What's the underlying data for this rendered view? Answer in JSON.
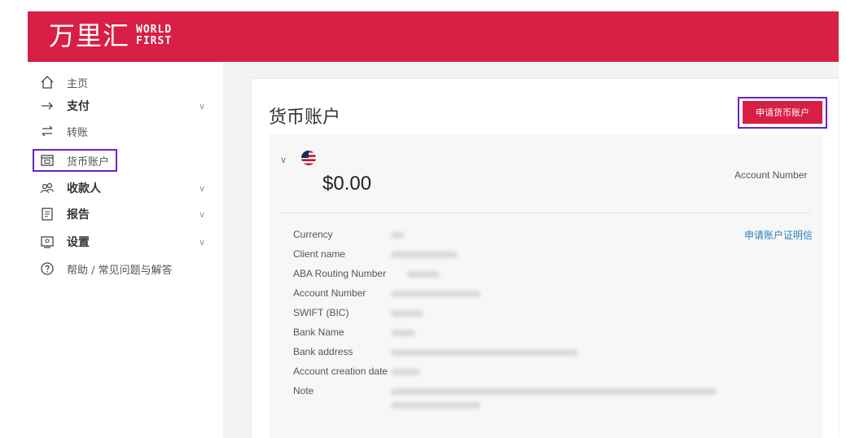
{
  "header": {
    "logo_cn": "万里汇",
    "logo_en_line1": "WORLD",
    "logo_en_line2": "FIRST",
    "bg_color": "#d81f45"
  },
  "sidebar": {
    "items": [
      {
        "label": "主页",
        "icon": "home-icon"
      },
      {
        "label": "支付",
        "icon": "arrow-right-icon",
        "expandable": true
      },
      {
        "label": "转账",
        "icon": "transfer-icon"
      },
      {
        "label": "货币账户",
        "icon": "wallet-icon",
        "highlighted": true
      },
      {
        "label": "收款人",
        "icon": "users-icon",
        "expandable": true
      },
      {
        "label": "报告",
        "icon": "report-icon",
        "expandable": true
      },
      {
        "label": "设置",
        "icon": "settings-icon",
        "expandable": true
      },
      {
        "label": "帮助 / 常见问题与解答",
        "icon": "help-icon"
      }
    ]
  },
  "main": {
    "title": "货币账户",
    "apply_button": "申请货币账户",
    "account": {
      "flag": "us-flag-icon",
      "balance": "$0.00",
      "account_number_label": "Account Number",
      "cert_link": "申请账户证明信",
      "details": [
        {
          "label": "Currency"
        },
        {
          "label": "Client name"
        },
        {
          "label": "ABA Routing Number"
        },
        {
          "label": "Account Number"
        },
        {
          "label": "SWIFT (BIC)"
        },
        {
          "label": "Bank Name"
        },
        {
          "label": "Bank address"
        },
        {
          "label": "Account creation date"
        },
        {
          "label": "Note"
        }
      ]
    }
  },
  "colors": {
    "accent": "#d81f45",
    "highlight": "#6b21c8",
    "link": "#2b7fbf"
  }
}
